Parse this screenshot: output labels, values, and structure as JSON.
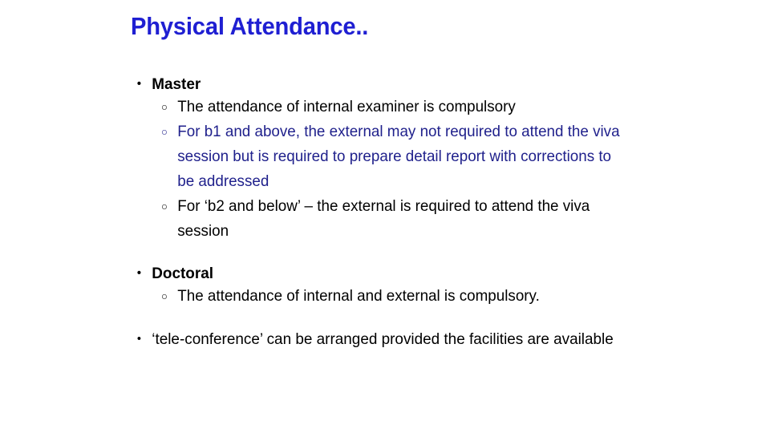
{
  "slide": {
    "title": "Physical Attendance..",
    "title_color": "#1f1fd2",
    "background_color": "#ffffff",
    "body_text_color": "#000000",
    "highlight_text_color": "#20218c",
    "bullet_marker": "•",
    "sub_bullet_marker": "○",
    "blocks": [
      {
        "heading": "Master",
        "heading_bold": true,
        "items": [
          {
            "text": "The attendance of internal examiner is compulsory",
            "color": "black"
          },
          {
            "text": "For b1 and above, the external may not required to attend the viva session but is required to prepare detail report with corrections to be addressed",
            "color": "blue"
          },
          {
            "text": "For ‘b2 and below’ – the external is required to attend the viva session",
            "color": "black"
          }
        ]
      },
      {
        "heading": "Doctoral",
        "heading_bold": true,
        "items": [
          {
            "text": "The attendance of internal and external is compulsory.",
            "color": "black"
          }
        ]
      },
      {
        "heading": "‘tele-conference’ can be arranged provided the facilities are available",
        "heading_bold": false,
        "items": []
      }
    ]
  }
}
